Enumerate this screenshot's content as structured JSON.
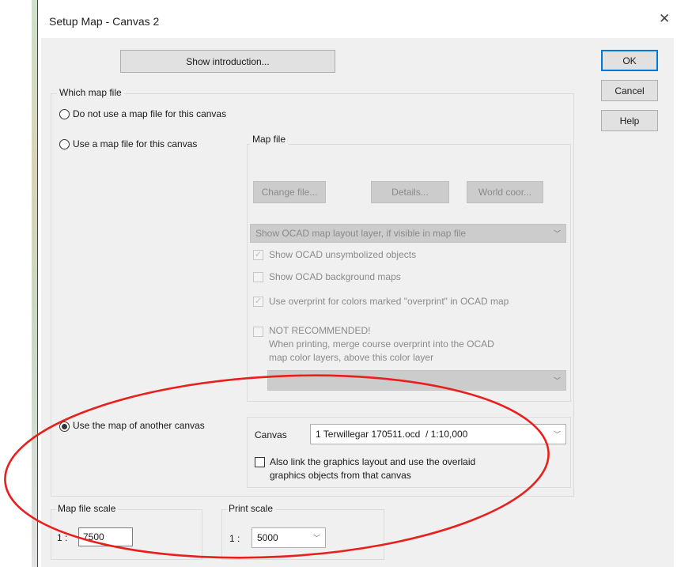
{
  "window": {
    "title": "Setup Map - Canvas 2",
    "close_icon": "close-icon"
  },
  "buttons": {
    "show_intro": "Show introduction...",
    "ok": "OK",
    "cancel": "Cancel",
    "help": "Help"
  },
  "which_map_file": {
    "title": "Which map file",
    "no_map_label": "Do not use a map file for this canvas",
    "use_map_label": "Use a map file for this canvas",
    "selected": "use_other_canvas"
  },
  "map_file": {
    "title": "Map file",
    "change_file": "Change file...",
    "details": "Details...",
    "world_coor": "World coor...",
    "layout_combo": "Show OCAD map layout layer, if visible in map file",
    "opt_unsymbolized": "Show OCAD unsymbolized objects",
    "opt_background": "Show OCAD background maps",
    "opt_overprint": "Use overprint for colors marked \"overprint\" in OCAD map",
    "opt_not_recommended_1": "NOT RECOMMENDED!",
    "opt_not_recommended_2": "When printing, merge course overprint into the OCAD",
    "opt_not_recommended_3": "map color layers, above this color layer",
    "color_layer_combo": "",
    "checked": {
      "unsymbolized": true,
      "background": false,
      "overprint": true,
      "not_recommended": false
    }
  },
  "other_canvas": {
    "radio_label": "Use the map of another canvas",
    "canvas_label": "Canvas",
    "canvas_value": "1 Terwillegar 170511.ocd  / 1:10,000",
    "link_label_1": "Also link the graphics layout and use the overlaid",
    "link_label_2": "graphics objects from that canvas",
    "link_checked": false
  },
  "map_file_scale": {
    "title": "Map file scale",
    "prefix": "1 :",
    "value": "7500"
  },
  "print_scale": {
    "title": "Print scale",
    "prefix": "1 :",
    "value": "5000"
  },
  "annotation": {
    "ellipse_color": "#e8201d"
  }
}
